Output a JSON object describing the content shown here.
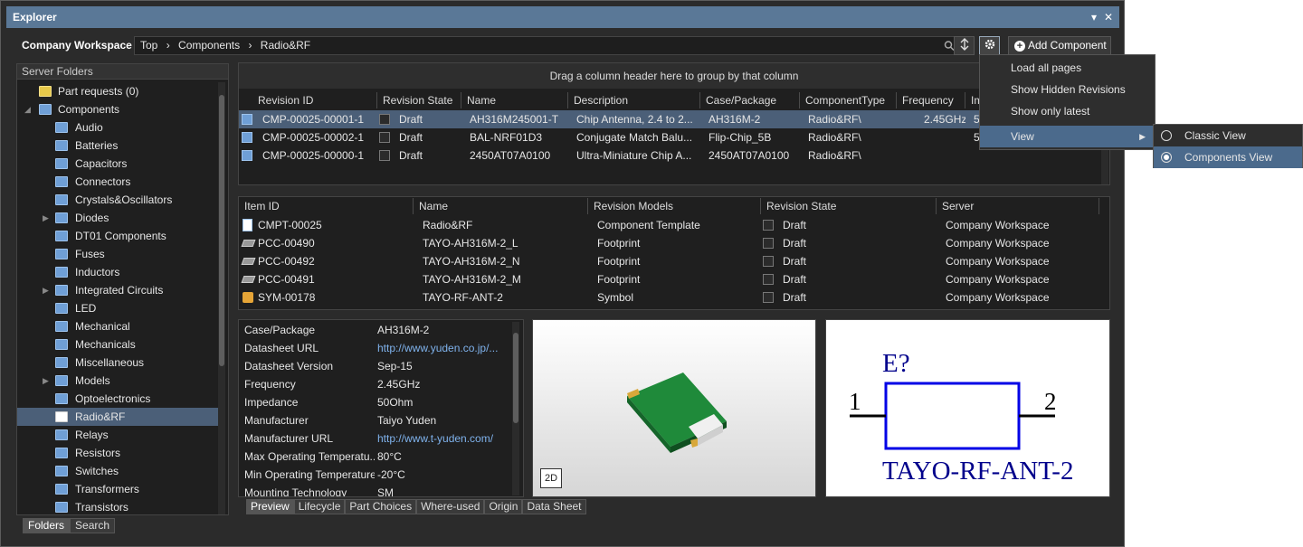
{
  "window": {
    "title": "Explorer",
    "pin_glyph": "▾",
    "close_glyph": "✕"
  },
  "toolbar": {
    "workspace_label": "Company Workspace ▾",
    "breadcrumb": [
      "Top",
      "Components",
      "Radio&RF"
    ],
    "separator": "›",
    "add_component_label": "Add Component"
  },
  "folders": {
    "header": "Server Folders",
    "items": [
      {
        "label": "Part requests (0)"
      },
      {
        "label": "Components"
      },
      {
        "label": "Audio"
      },
      {
        "label": "Batteries"
      },
      {
        "label": "Capacitors"
      },
      {
        "label": "Connectors"
      },
      {
        "label": "Crystals&Oscillators"
      },
      {
        "label": "Diodes"
      },
      {
        "label": "DT01 Components"
      },
      {
        "label": "Fuses"
      },
      {
        "label": "Inductors"
      },
      {
        "label": "Integrated Circuits"
      },
      {
        "label": "LED"
      },
      {
        "label": "Mechanical"
      },
      {
        "label": "Mechanicals"
      },
      {
        "label": "Miscellaneous"
      },
      {
        "label": "Models"
      },
      {
        "label": "Optoelectronics"
      },
      {
        "label": "Radio&RF"
      },
      {
        "label": "Relays"
      },
      {
        "label": "Resistors"
      },
      {
        "label": "Switches"
      },
      {
        "label": "Transformers"
      },
      {
        "label": "Transistors"
      }
    ],
    "tabs": [
      "Folders",
      "Search"
    ]
  },
  "revisions": {
    "group_hint": "Drag a column header here to group by that column",
    "columns": [
      "Revision ID",
      "Revision State",
      "Name",
      "Description",
      "Case/Package",
      "ComponentType",
      "Frequency",
      "Im"
    ],
    "rows": [
      [
        "CMP-00025-00001-1",
        "Draft",
        "AH316M245001-T",
        "Chip Antenna, 2.4 to 2...",
        "AH316M-2",
        "Radio&RF\\",
        "2.45GHz",
        "5"
      ],
      [
        "CMP-00025-00002-1",
        "Draft",
        "BAL-NRF01D3",
        "Conjugate Match Balu...",
        "Flip-Chip_5B",
        "Radio&RF\\",
        "",
        "5"
      ],
      [
        "CMP-00025-00000-1",
        "Draft",
        "2450AT07A0100",
        "Ultra-Miniature Chip A...",
        "2450AT07A0100",
        "Radio&RF\\",
        "",
        ""
      ]
    ]
  },
  "items": {
    "columns": [
      "Item ID",
      "Name",
      "Revision Models",
      "Revision State",
      "Server"
    ],
    "rows": [
      [
        "CMPT-00025",
        "Radio&RF",
        "Component Template",
        "Draft",
        "Company Workspace"
      ],
      [
        "PCC-00490",
        "TAYO-AH316M-2_L",
        "Footprint",
        "Draft",
        "Company Workspace"
      ],
      [
        "PCC-00492",
        "TAYO-AH316M-2_N",
        "Footprint",
        "Draft",
        "Company Workspace"
      ],
      [
        "PCC-00491",
        "TAYO-AH316M-2_M",
        "Footprint",
        "Draft",
        "Company Workspace"
      ],
      [
        "SYM-00178",
        "TAYO-RF-ANT-2",
        "Symbol",
        "Draft",
        "Company Workspace"
      ]
    ]
  },
  "properties": [
    {
      "key": "Case/Package",
      "value": "AH316M-2"
    },
    {
      "key": "Datasheet URL",
      "value": "http://www.yuden.co.jp/...",
      "link": true
    },
    {
      "key": "Datasheet Version",
      "value": "Sep-15"
    },
    {
      "key": "Frequency",
      "value": "2.45GHz"
    },
    {
      "key": "Impedance",
      "value": "50Ohm"
    },
    {
      "key": "Manufacturer",
      "value": "Taiyo Yuden"
    },
    {
      "key": "Manufacturer URL",
      "value": "http://www.t-yuden.com/",
      "link": true
    },
    {
      "key": "Max Operating Temperatu...",
      "value": "80°C"
    },
    {
      "key": "Min Operating Temperature",
      "value": "-20°C"
    },
    {
      "key": "Mounting Technology",
      "value": "SM"
    }
  ],
  "preview_tabs": [
    "Preview",
    "Lifecycle",
    "Part Choices",
    "Where-used",
    "Origin",
    "Data Sheet"
  ],
  "preview": {
    "view_2d_label": "2D",
    "symbol_designator": "E?",
    "symbol_pin1": "1",
    "symbol_pin2": "2",
    "symbol_comment": "TAYO-RF-ANT-2"
  },
  "menu": {
    "items": [
      "Load all pages",
      "Show Hidden Revisions",
      "Show only latest",
      "View"
    ],
    "submenu_arrow": "▶",
    "submenu": [
      "Classic View",
      "Components View"
    ]
  },
  "colors": {
    "selection": "#4b5f78",
    "title_bar": "#5a7897",
    "menu_highlight": "#4b6a8c"
  }
}
